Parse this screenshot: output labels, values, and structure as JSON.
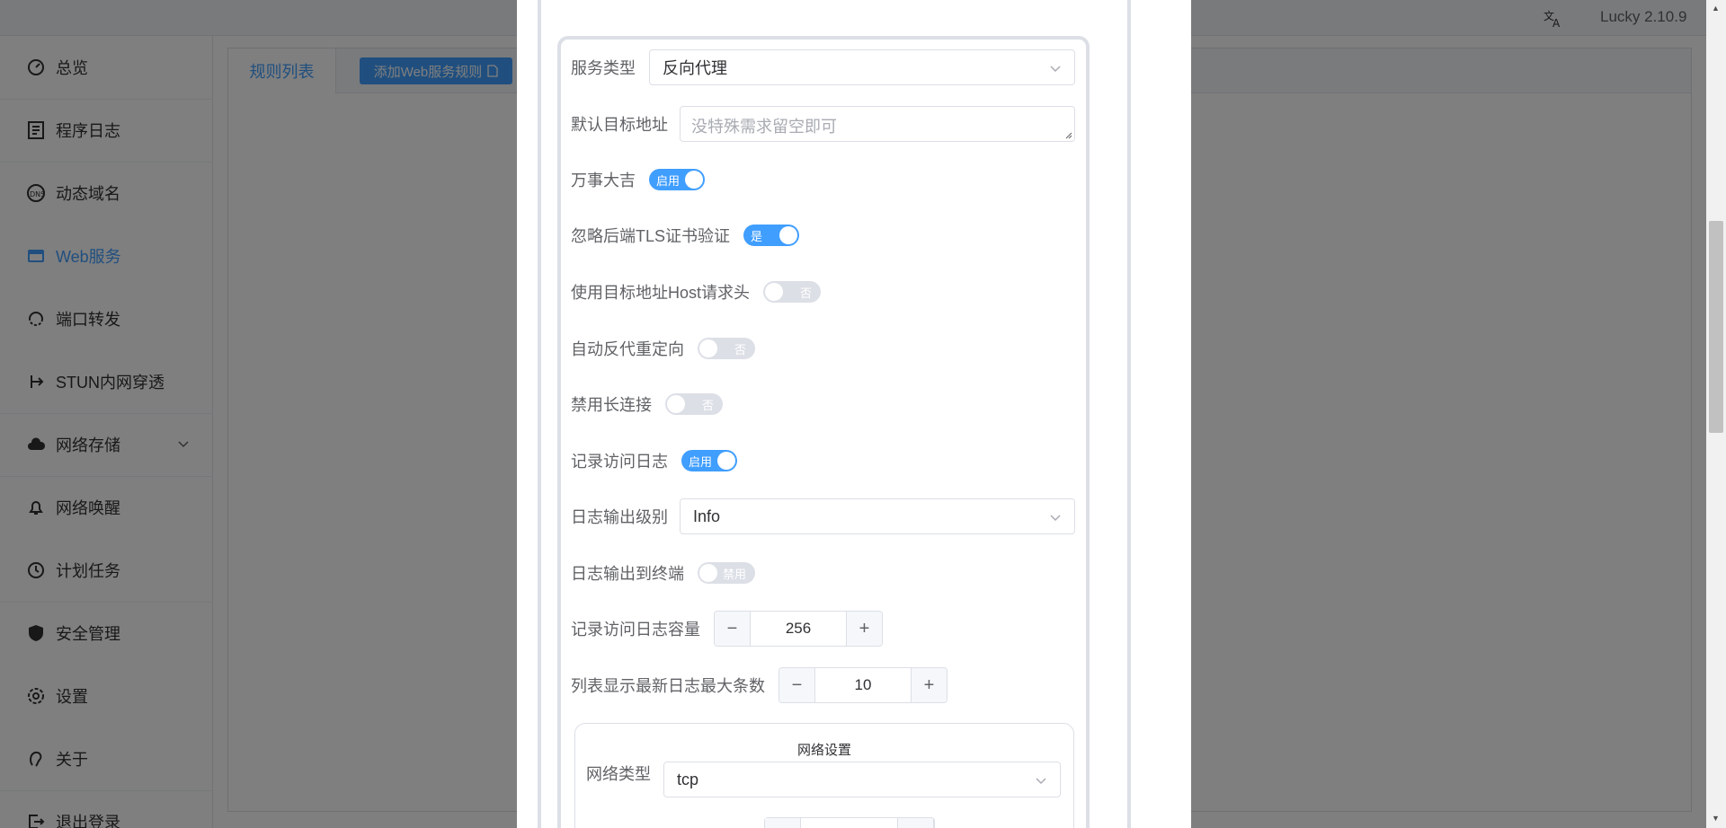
{
  "app": {
    "version": "Lucky 2.10.9",
    "translate_icon": "translate-icon"
  },
  "sidebar": {
    "items": [
      {
        "label": "总览",
        "icon": "dashboard-icon"
      },
      {
        "label": "程序日志",
        "icon": "log-icon"
      },
      {
        "label": "动态域名",
        "icon": "dns-icon"
      },
      {
        "label": "Web服务",
        "icon": "web-service-icon",
        "active": true
      },
      {
        "label": "端口转发",
        "icon": "port-forward-icon"
      },
      {
        "label": "STUN内网穿透",
        "icon": "stun-icon"
      },
      {
        "label": "网络存储",
        "icon": "cloud-icon",
        "expandable": true
      },
      {
        "label": "网络唤醒",
        "icon": "bell-icon"
      },
      {
        "label": "计划任务",
        "icon": "clock-icon"
      },
      {
        "label": "安全管理",
        "icon": "shield-icon"
      },
      {
        "label": "设置",
        "icon": "gear-icon"
      },
      {
        "label": "关于",
        "icon": "about-icon"
      },
      {
        "label": "退出登录",
        "icon": "logout-icon"
      }
    ]
  },
  "content": {
    "tab_label": "规则列表",
    "add_button": "添加Web服务规则"
  },
  "form": {
    "service_type": {
      "label": "服务类型",
      "value": "反向代理"
    },
    "default_target": {
      "label": "默认目标地址",
      "placeholder": "没特殊需求留空即可"
    },
    "wanshi": {
      "label": "万事大吉",
      "state": "启用",
      "on": true
    },
    "ignore_tls": {
      "label": "忽略后端TLS证书验证",
      "state": "是",
      "on": true
    },
    "use_host": {
      "label": "使用目标地址Host请求头",
      "state": "否",
      "on": false
    },
    "auto_redirect": {
      "label": "自动反代重定向",
      "state": "否",
      "on": false
    },
    "disable_keepalive": {
      "label": "禁用长连接",
      "state": "否",
      "on": false
    },
    "access_log": {
      "label": "记录访问日志",
      "state": "启用",
      "on": true
    },
    "log_level": {
      "label": "日志输出级别",
      "value": "Info"
    },
    "log_terminal": {
      "label": "日志输出到终端",
      "state": "禁用",
      "on": false
    },
    "log_capacity": {
      "label": "记录访问日志容量",
      "value": "256"
    },
    "list_max": {
      "label": "列表显示最新日志最大条数",
      "value": "10"
    },
    "network": {
      "title": "网络设置",
      "type_label": "网络类型",
      "type_value": "tcp"
    }
  }
}
